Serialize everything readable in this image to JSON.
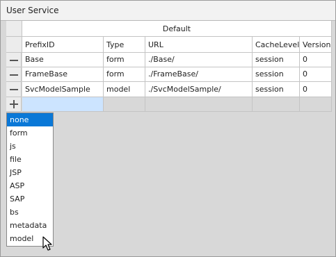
{
  "window": {
    "title": "User Service"
  },
  "table": {
    "group_header": "Default",
    "columns": [
      "PrefixID",
      "Type",
      "URL",
      "CacheLevel",
      "Version"
    ],
    "rows": [
      [
        "Base",
        "form",
        "./Base/",
        "session",
        "0"
      ],
      [
        "FrameBase",
        "form",
        "./FrameBase/",
        "session",
        "0"
      ],
      [
        "SvcModelSample",
        "model",
        "./SvcModelSample/",
        "session",
        "0"
      ]
    ],
    "row_action_icon": "minus-icon",
    "add_action_icon": "plus-icon"
  },
  "dropdown": {
    "options": [
      "none",
      "form",
      "js",
      "file",
      "JSP",
      "ASP",
      "SAP",
      "bs",
      "metadata",
      "model"
    ],
    "selected": "none",
    "selected_color": "#0a78d7"
  },
  "colors": {
    "panel_bg": "#d8d8d8",
    "new_row_active": "#cce4ff"
  }
}
